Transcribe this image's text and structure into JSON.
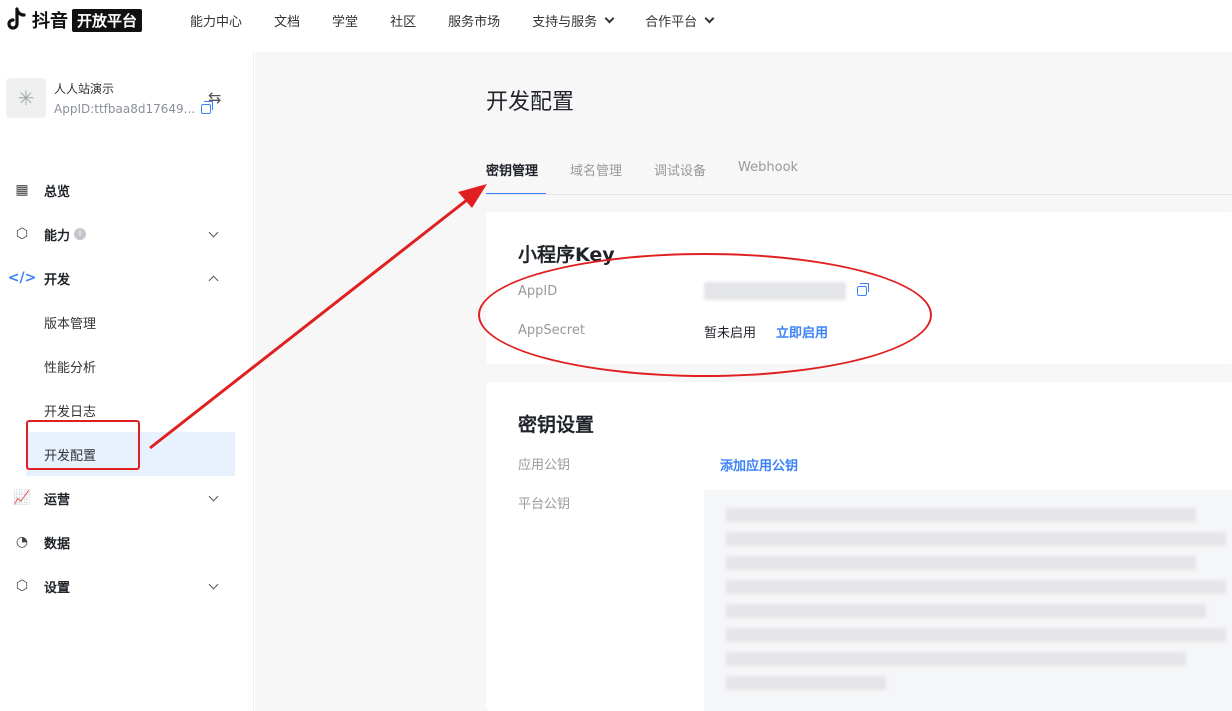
{
  "brand": {
    "name": "抖音",
    "badge": "开放平台"
  },
  "nav": [
    {
      "label": "能力中心"
    },
    {
      "label": "文档"
    },
    {
      "label": "学堂"
    },
    {
      "label": "社区"
    },
    {
      "label": "服务市场"
    },
    {
      "label": "支持与服务",
      "dropdown": true
    },
    {
      "label": "合作平台",
      "dropdown": true
    }
  ],
  "app": {
    "name": "人人站演示",
    "app_id": "AppID:ttfbaa8d17649..."
  },
  "sidebar": {
    "overview": "总览",
    "ability": "能力",
    "develop": "开发",
    "sub": [
      "版本管理",
      "性能分析",
      "开发日志",
      "开发配置"
    ],
    "operate": "运营",
    "data": "数据",
    "settings": "设置"
  },
  "page": {
    "title": "开发配置",
    "tabs": [
      "密钥管理",
      "域名管理",
      "调试设备",
      "Webhook"
    ]
  },
  "key_card": {
    "title": "小程序Key",
    "appid_label": "AppID",
    "appsecret_label": "AppSecret",
    "appsecret_status": "暂未启用",
    "appsecret_action": "立即启用"
  },
  "secret_card": {
    "title": "密钥设置",
    "app_pubkey_label": "应用公钥",
    "app_pubkey_action": "添加应用公钥",
    "platform_pubkey_label": "平台公钥"
  },
  "colors": {
    "accent": "#3b82f6",
    "annotation": "#e02020"
  }
}
